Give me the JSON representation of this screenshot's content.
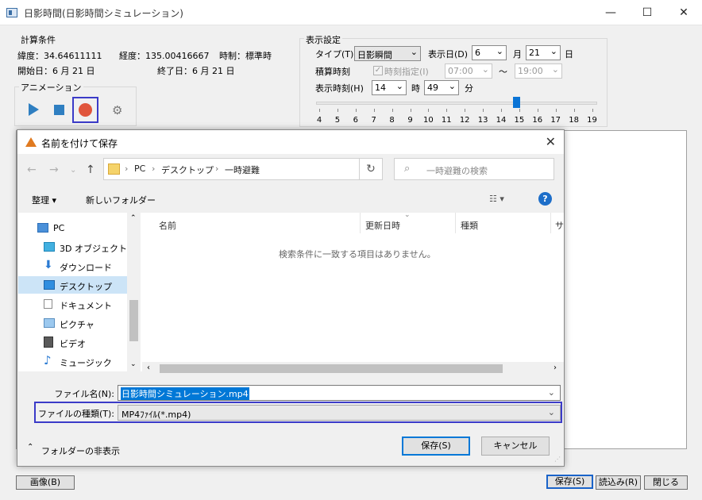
{
  "window": {
    "title": "日影時間(日影時間シミュレーション)",
    "minimize": "—",
    "maximize": "☐",
    "close": "✕"
  },
  "calc": {
    "group_label": "計算条件",
    "latitude": "緯度：34.64611111",
    "longitude": "経度：135.00416667",
    "timezone": "時制：標準時",
    "start_date": "開始日：6 月 21 日",
    "end_date": "終了日：6 月 21 日"
  },
  "animation": {
    "group_label": "アニメーション"
  },
  "display": {
    "group_label": "表示設定",
    "type_label": "タイプ(T)",
    "type_value": "日影瞬間",
    "date_label": "表示日(D)",
    "month_value": "6",
    "month_unit": "月",
    "day_value": "21",
    "day_unit": "日",
    "cumulative_label": "積算時刻",
    "time_spec_label": "時刻指定(I)",
    "time_from": "07:00",
    "tilde": "〜",
    "time_to": "19:00",
    "display_time_label": "表示時刻(H)",
    "hour_value": "14",
    "hour_unit": "時",
    "minute_value": "49",
    "minute_unit": "分",
    "slider_ticks": [
      "4",
      "5",
      "6",
      "7",
      "8",
      "9",
      "10",
      "11",
      "12",
      "13",
      "14",
      "15",
      "16",
      "17",
      "18",
      "19"
    ],
    "slider_value": 14.82
  },
  "bottom": {
    "image_btn": "画像(B)",
    "save_btn": "保存(S)",
    "load_btn": "読込み(R)",
    "close_btn": "閉じる"
  },
  "dialog": {
    "title": "名前を付けて保存",
    "close": "✕",
    "breadcrumb": [
      "PC",
      "デスクトップ",
      "一時避難"
    ],
    "search_placeholder": "一時避難の検索",
    "organize": "整理 ▾",
    "new_folder": "新しいフォルダー",
    "help": "?",
    "nav_items": [
      {
        "label": "PC"
      },
      {
        "label": "3D オブジェクト"
      },
      {
        "label": "ダウンロード"
      },
      {
        "label": "デスクトップ"
      },
      {
        "label": "ドキュメント"
      },
      {
        "label": "ピクチャ"
      },
      {
        "label": "ビデオ"
      },
      {
        "label": "ミュージック"
      }
    ],
    "columns": [
      "名前",
      "更新日時",
      "種類",
      "サ"
    ],
    "empty_message": "検索条件に一致する項目はありません。",
    "filename_label": "ファイル名(N):",
    "filename_value": "日影時間シミュレーション.mp4",
    "filetype_label": "ファイルの種類(T):",
    "filetype_value": "MP4ﾌｧｲﾙ(*.mp4)",
    "hide_folders": "フォルダーの非表示",
    "save_btn": "保存(S)",
    "cancel_btn": "キャンセル"
  }
}
